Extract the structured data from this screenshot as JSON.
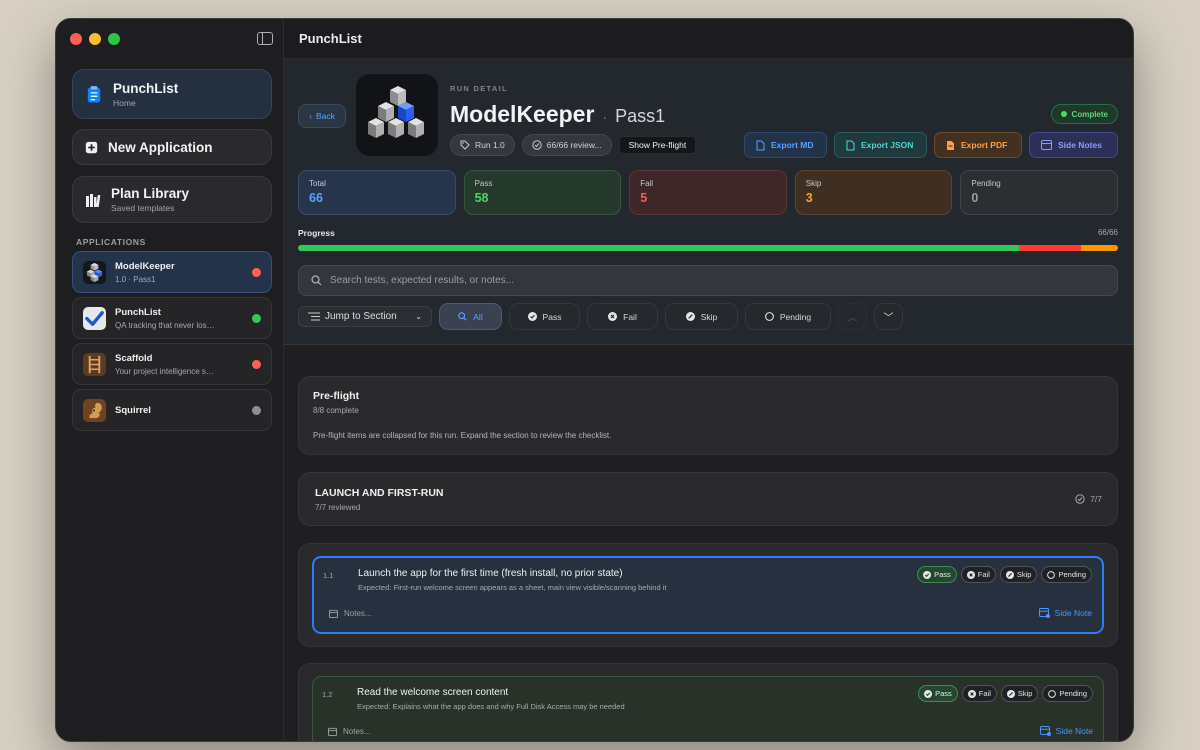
{
  "window": {
    "title": "PunchList"
  },
  "sidebar": {
    "home": {
      "title": "PunchList",
      "subtitle": "Home"
    },
    "new_application": {
      "label": "New Application"
    },
    "plan_library": {
      "title": "Plan Library",
      "subtitle": "Saved templates"
    },
    "applications_heading": "APPLICATIONS",
    "apps": [
      {
        "name": "ModelKeeper",
        "desc": "1.0 · Pass1",
        "status_color": "#ff5f57",
        "selected": true,
        "icon": "cube-stack-icon"
      },
      {
        "name": "PunchList",
        "desc": "QA tracking that never los…",
        "status_color": "#34c759",
        "selected": false,
        "icon": "checkmark-icon"
      },
      {
        "name": "Scaffold",
        "desc": "Your project intelligence s…",
        "status_color": "#ff5f57",
        "selected": false,
        "icon": "ladder-icon"
      },
      {
        "name": "Squirrel",
        "desc": "",
        "status_color": "#8e8e93",
        "selected": false,
        "icon": "squirrel-icon"
      }
    ]
  },
  "header": {
    "back_label": "Back",
    "eyebrow": "RUN DETAIL",
    "app_name": "ModelKeeper",
    "separator": "·",
    "run_name": "Pass1",
    "run_chip": "Run 1.0",
    "reviewed_chip": "66/66 review...",
    "preflight_btn": "Show Pre-flight",
    "status_badge": "Complete",
    "exports": {
      "md": "Export MD",
      "json": "Export JSON",
      "pdf": "Export PDF",
      "notes": "Side Notes"
    }
  },
  "stats": {
    "total": {
      "label": "Total",
      "value": "66"
    },
    "pass": {
      "label": "Pass",
      "value": "58"
    },
    "fail": {
      "label": "Fail",
      "value": "5"
    },
    "skip": {
      "label": "Skip",
      "value": "3"
    },
    "pending": {
      "label": "Pending",
      "value": "0"
    }
  },
  "progress": {
    "label": "Progress",
    "count": "66/66",
    "pass": 58,
    "fail": 5,
    "skip": 3,
    "total": 66
  },
  "search": {
    "placeholder": "Search tests, expected results, or notes..."
  },
  "filters": {
    "jump": "Jump to Section",
    "all": "All",
    "pass": "Pass",
    "fail": "Fail",
    "skip": "Skip",
    "pending": "Pending"
  },
  "sections": {
    "preflight": {
      "title": "Pre-flight",
      "sub": "8/8 complete",
      "note": "Pre-flight items are collapsed for this run. Expand the section to review the checklist."
    },
    "launch": {
      "title": "LAUNCH AND FIRST-RUN",
      "sub": "7/7 reviewed",
      "count": "7/7"
    }
  },
  "items": [
    {
      "num": "1.1",
      "title": "Launch the app for the first time (fresh install, no prior state)",
      "expected": "Expected: First-run welcome screen appears as a sheet, main view visible/scanning behind it",
      "notes": "Notes...",
      "side_note": "Side Note",
      "pills": [
        "Pass",
        "Fail",
        "Skip",
        "Pending"
      ]
    },
    {
      "num": "1.2",
      "title": "Read the welcome screen content",
      "expected": "Expected: Explains what the app does and why Full Disk Access may be needed",
      "notes": "Notes...",
      "side_note": "Side Note",
      "pills": [
        "Pass",
        "Fail",
        "Skip",
        "Pending"
      ]
    }
  ]
}
